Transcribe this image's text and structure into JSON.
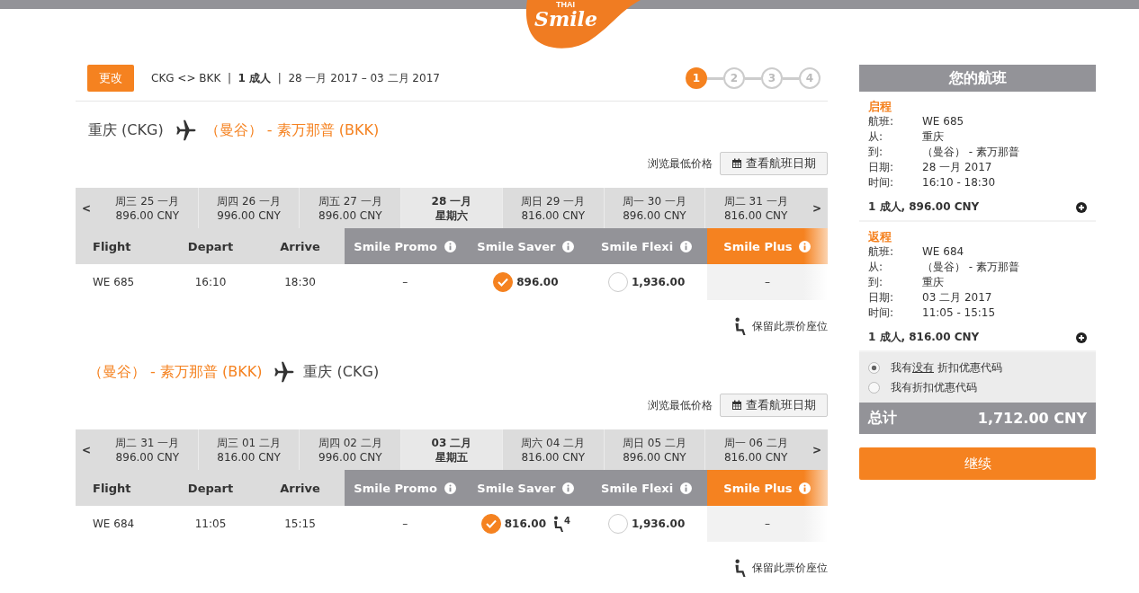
{
  "logo": {
    "sub": "THAI",
    "brand": "Smile"
  },
  "header": {
    "change_button": "更改",
    "summary": "CKG <> BKK  |  **1 成人**  |  28 一月 2017 – 03 二月 2017"
  },
  "steps": [
    {
      "label": "1",
      "selected": true
    },
    {
      "label": "2",
      "selected": false
    },
    {
      "label": "3",
      "selected": false
    },
    {
      "label": "4",
      "selected": false
    }
  ],
  "journeys": [
    {
      "title": [
        {
          "text": "重庆 (CKG)",
          "highlight": false
        },
        {
          "text": "（曼谷） - 素万那普 (BKK)",
          "highlight": true
        }
      ],
      "browse_label": "浏览最低价格",
      "calendar_button": "查看航班日期",
      "prev": "<",
      "next": ">",
      "dates": [
        {
          "line1": "周三 25 一月",
          "line2": "896.00 CNY",
          "selected": false
        },
        {
          "line1": "周四 26 一月",
          "line2": "996.00 CNY",
          "selected": false
        },
        {
          "line1": "周五 27 一月",
          "line2": "896.00 CNY",
          "selected": false
        },
        {
          "line1": "28 一月",
          "line2": "星期六",
          "selected": true
        },
        {
          "line1": "周日 29 一月",
          "line2": "816.00 CNY",
          "selected": false
        },
        {
          "line1": "周一 30 一月",
          "line2": "896.00 CNY",
          "selected": false
        },
        {
          "line1": "周二 31 一月",
          "line2": "816.00 CNY",
          "selected": false
        }
      ],
      "columns": [
        "Flight",
        "Depart",
        "Arrive"
      ],
      "fares": [
        {
          "name": "Smile Promo",
          "selected": false
        },
        {
          "name": "Smile Saver",
          "selected": false
        },
        {
          "name": "Smile Flexi",
          "selected": false
        },
        {
          "name": "Smile Plus",
          "selected": true
        }
      ],
      "row": {
        "flight": "WE 685",
        "depart": "16:10",
        "arrive": "18:30",
        "cells": [
          {
            "kind": "none",
            "text": "–"
          },
          {
            "kind": "radio",
            "selected": true,
            "price": "896.00"
          },
          {
            "kind": "radio",
            "selected": false,
            "price": "1,936.00"
          },
          {
            "kind": "none",
            "text": "–"
          }
        ]
      },
      "hold": "保留此票价座位"
    },
    {
      "title": [
        {
          "text": "（曼谷） - 素万那普 (BKK)",
          "highlight": true
        },
        {
          "text": "重庆 (CKG)",
          "highlight": false
        }
      ],
      "browse_label": "浏览最低价格",
      "calendar_button": "查看航班日期",
      "prev": "<",
      "next": ">",
      "dates": [
        {
          "line1": "周二 31 一月",
          "line2": "896.00 CNY",
          "selected": false
        },
        {
          "line1": "周三 01 二月",
          "line2": "816.00 CNY",
          "selected": false
        },
        {
          "line1": "周四 02 二月",
          "line2": "996.00 CNY",
          "selected": false
        },
        {
          "line1": "03 二月",
          "line2": "星期五",
          "selected": true
        },
        {
          "line1": "周六 04 二月",
          "line2": "816.00 CNY",
          "selected": false
        },
        {
          "line1": "周日 05 二月",
          "line2": "896.00 CNY",
          "selected": false
        },
        {
          "line1": "周一 06 二月",
          "line2": "816.00 CNY",
          "selected": false
        }
      ],
      "columns": [
        "Flight",
        "Depart",
        "Arrive"
      ],
      "fares": [
        {
          "name": "Smile Promo",
          "selected": false
        },
        {
          "name": "Smile Saver",
          "selected": false
        },
        {
          "name": "Smile Flexi",
          "selected": false
        },
        {
          "name": "Smile Plus",
          "selected": true
        }
      ],
      "row": {
        "flight": "WE 684",
        "depart": "11:05",
        "arrive": "15:15",
        "cells": [
          {
            "kind": "none",
            "text": "–"
          },
          {
            "kind": "radio",
            "selected": true,
            "price": "816.00",
            "seats_left": "4"
          },
          {
            "kind": "radio",
            "selected": false,
            "price": "1,936.00"
          },
          {
            "kind": "none",
            "text": "–"
          }
        ]
      },
      "hold": "保留此票价座位"
    }
  ],
  "sidebar": {
    "title": "您的航班",
    "segments": [
      {
        "heading": "启程",
        "fields": [
          {
            "label": "航班:",
            "value": "WE 685"
          },
          {
            "label": "从:",
            "value": "重庆"
          },
          {
            "label": "到:",
            "value": "（曼谷） - 素万那普"
          },
          {
            "label": "日期:",
            "value": "28 一月 2017"
          },
          {
            "label": "时间:",
            "value": "16:10 - 18:30"
          }
        ],
        "summary": "1 成人, 896.00 CNY"
      },
      {
        "heading": "返程",
        "fields": [
          {
            "label": "航班:",
            "value": "WE 684"
          },
          {
            "label": "从:",
            "value": "（曼谷） - 素万那普"
          },
          {
            "label": "到:",
            "value": "重庆"
          },
          {
            "label": "日期:",
            "value": "03 二月 2017"
          },
          {
            "label": "时间:",
            "value": "11:05 - 15:15"
          }
        ],
        "summary": "1 成人, 816.00 CNY"
      }
    ],
    "promo_options": [
      {
        "before": "我有",
        "link": "没有",
        "after": "折扣优惠代码",
        "selected": true
      },
      {
        "before": "我有折扣优惠代码",
        "selected": false
      }
    ],
    "total_label": "总计",
    "total_value": "1,712.00 CNY",
    "continue_button": "继续"
  }
}
